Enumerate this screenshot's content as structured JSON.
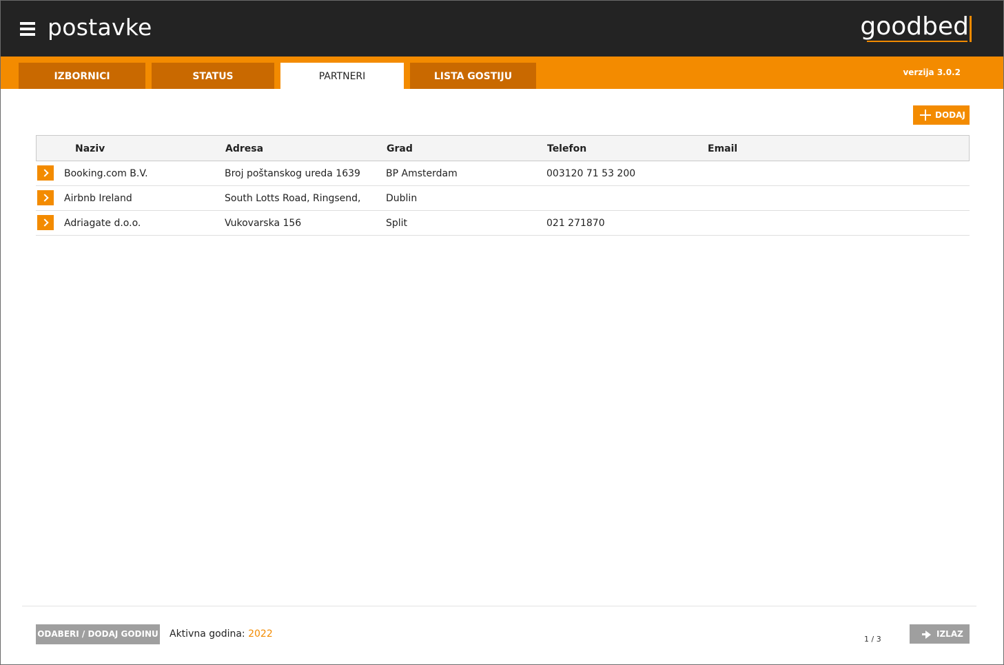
{
  "header": {
    "title": "postavke",
    "logo": "goodbed",
    "menu_icon": "hamburger-menu-icon"
  },
  "tabs": [
    {
      "label": "IZBORNICI",
      "active": false
    },
    {
      "label": "STATUS",
      "active": false
    },
    {
      "label": "PARTNERI",
      "active": true
    },
    {
      "label": "LISTA GOSTIJU",
      "active": false
    }
  ],
  "version": "verzija 3.0.2",
  "toolbar": {
    "add_label": "DODAJ",
    "add_icon": "plus-icon"
  },
  "table": {
    "columns": [
      "Naziv",
      "Adresa",
      "Grad",
      "Telefon",
      "Email"
    ],
    "rows": [
      {
        "naziv": "Booking.com B.V.",
        "adresa": "Broj poštanskog ureda 1639",
        "grad": "BP Amsterdam",
        "telefon": "003120 71 53 200",
        "email": ""
      },
      {
        "naziv": "Airbnb Ireland",
        "adresa": "South Lotts Road, Ringsend,",
        "grad": "Dublin",
        "telefon": "",
        "email": ""
      },
      {
        "naziv": "Adriagate d.o.o.",
        "adresa": "Vukovarska 156",
        "grad": "Split",
        "telefon": "021 271870",
        "email": ""
      }
    ]
  },
  "footer": {
    "year_button": "ODABERI / DODAJ GODINU",
    "active_year_label": "Aktivna godina:",
    "active_year": "2022",
    "pager": "1 / 3",
    "exit_label": "IZLAZ",
    "exit_icon": "arrow-right-icon"
  },
  "colors": {
    "accent": "#f38b00",
    "tab_inactive": "#c96900",
    "header_bg": "#232323",
    "button_gray": "#9f9f9f"
  }
}
